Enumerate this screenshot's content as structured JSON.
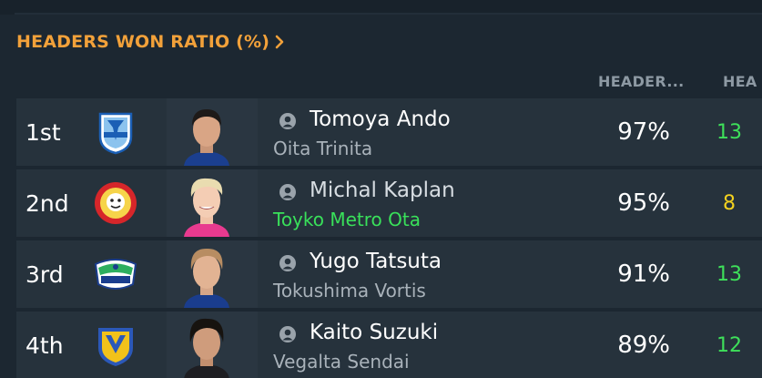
{
  "widget": {
    "title": "HEADERS WON RATIO (%)",
    "columns": [
      {
        "label": "HEADER..."
      },
      {
        "label": "HEA"
      }
    ],
    "rows": [
      {
        "rank": "1st",
        "name": "Tomoya Ando",
        "club": "Oita Trinita",
        "club_highlight": false,
        "pct": "97%",
        "count": "13",
        "count_color": "#3ee05a",
        "badge_icon": "oita-trinita-crest",
        "club_colors": [
          "#1b5fb5",
          "#8cc3ee"
        ]
      },
      {
        "rank": "2nd",
        "name": "Michal Kaplan",
        "club": "Toyko Metro Ota",
        "club_highlight": true,
        "pct": "95%",
        "count": "8",
        "count_color": "#f4d21f",
        "badge_icon": "toyko-metro-ota-crest",
        "club_colors": [
          "#d6262a",
          "#f6d44a"
        ]
      },
      {
        "rank": "3rd",
        "name": "Yugo Tatsuta",
        "club": "Tokushima Vortis",
        "club_highlight": false,
        "pct": "91%",
        "count": "13",
        "count_color": "#3ee05a",
        "badge_icon": "tokushima-vortis-crest",
        "club_colors": [
          "#1a3d8e",
          "#2eae5f"
        ]
      },
      {
        "rank": "4th",
        "name": "Kaito Suzuki",
        "club": "Vegalta Sendai",
        "club_highlight": false,
        "pct": "89%",
        "count": "12",
        "count_color": "#3ee05a",
        "badge_icon": "vegalta-sendai-crest",
        "club_colors": [
          "#f2c21a",
          "#2b58b8"
        ]
      }
    ]
  }
}
